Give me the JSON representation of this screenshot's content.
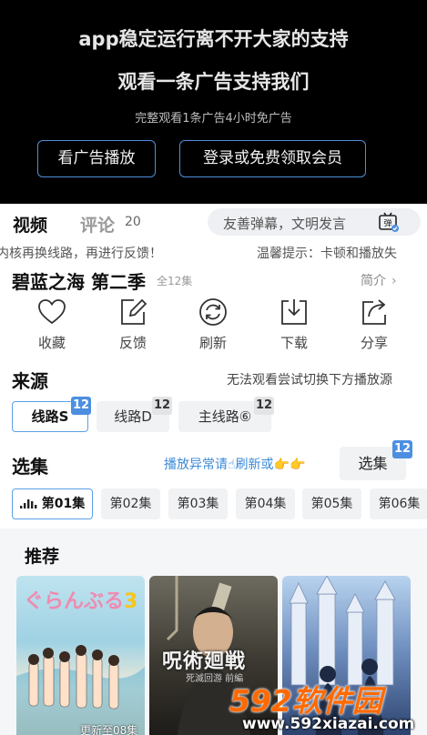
{
  "ad": {
    "line1": "app稳定运行离不开大家的支持",
    "line2": "观看一条广告支持我们",
    "line3": "完整观看1条广告4小时免广告",
    "button_watch_ad": "看广告播放",
    "button_login": "登录或免费领取会员"
  },
  "tabs": {
    "video": "视频",
    "comment": "评论",
    "comment_count": "20",
    "danmu_placeholder": "友善弹幕，文明发言",
    "danmu_icon_text": "弹"
  },
  "marquee": {
    "left": "内核再换线路，再进行反馈！",
    "right": "温馨提示：卡顿和播放失"
  },
  "show": {
    "title": "碧蓝之海 第二季",
    "episode_total": "全12集",
    "intro": "简介",
    "intro_chevron": "›"
  },
  "actions": [
    {
      "label": "收藏",
      "icon": "heart-icon"
    },
    {
      "label": "反馈",
      "icon": "edit-icon"
    },
    {
      "label": "刷新",
      "icon": "refresh-icon"
    },
    {
      "label": "下载",
      "icon": "download-icon"
    },
    {
      "label": "分享",
      "icon": "share-icon"
    }
  ],
  "source": {
    "title": "来源",
    "hint": "无法观看尝试切换下方播放源",
    "lines": [
      {
        "label": "线路S",
        "count": "12",
        "active": true
      },
      {
        "label": "线路D",
        "count": "12",
        "active": false
      },
      {
        "label": "主线路⑥",
        "count": "12",
        "active": false
      }
    ]
  },
  "episodes": {
    "title": "选集",
    "hint": "播放异常请☝刷新或👉👉",
    "select_label": "选集",
    "select_count": "12",
    "items": [
      "第01集",
      "第02集",
      "第03集",
      "第04集",
      "第05集",
      "第06集"
    ]
  },
  "recommend": {
    "title": "推荐",
    "posters": [
      {
        "title_text": "ぐらんぶる",
        "title_num": "3",
        "update": "更新至08集"
      },
      {
        "title_text": "呪術廻戦",
        "sub": "死滅回游 前編"
      },
      {}
    ]
  },
  "watermark": {
    "brand": "592软件园",
    "url": "www.592xiazai.com"
  },
  "colors": {
    "accent_blue": "#4c8fe0",
    "ad_button_border": "#4d8fd6",
    "hint_blue": "#3a8ad6",
    "watermark_orange": "#ff6a00"
  }
}
